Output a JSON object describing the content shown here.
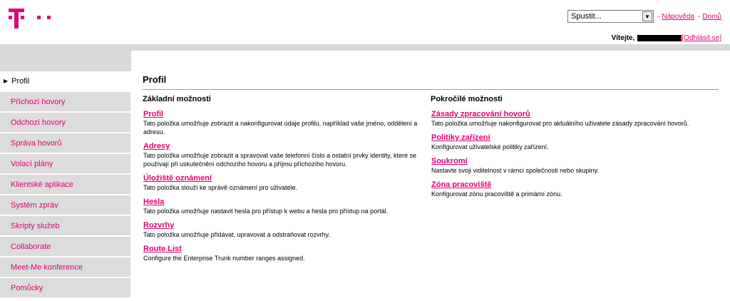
{
  "header": {
    "run_select_value": "Spustit...",
    "help_label": "Nápověda",
    "home_label": "Domů",
    "welcome_label": "Vítejte,",
    "logout_label": "[Odhlásit se]",
    "separator": "-"
  },
  "sidebar": {
    "items": [
      {
        "label": "Profil",
        "active": true
      },
      {
        "label": "Příchozí hovory"
      },
      {
        "label": "Odchozí hovory"
      },
      {
        "label": "Správa hovorů"
      },
      {
        "label": "Volací plány"
      },
      {
        "label": "Klientské aplikace"
      },
      {
        "label": "Systém zpráv"
      },
      {
        "label": "Skripty služeb"
      },
      {
        "label": "Collaborate"
      },
      {
        "label": "Meet-Me konference"
      },
      {
        "label": "Pomůcky"
      }
    ]
  },
  "main": {
    "title": "Profil",
    "basic": {
      "heading": "Základní možnosti",
      "items": [
        {
          "name": "Profil",
          "desc": "Tato položka umožňuje zobrazit a nakonfigurovat údaje profilu, například vaše jméno, oddělení a adresu."
        },
        {
          "name": "Adresy",
          "desc": "Tato položka umožňuje zobrazit a spravovat vaše telefonní číslo a ostatní prvky identity, které se používají při uskutečnění odchozího hovoru a příjmu příchozího hovoru."
        },
        {
          "name": "Úložiště oznámení",
          "desc": "Tato položka slouží ke správě oznámení pro uživatele."
        },
        {
          "name": "Hesla",
          "desc": "Tato položka umožňuje nastavit hesla pro přístup k webu a hesla pro přístup na portál."
        },
        {
          "name": "Rozvrhy",
          "desc": "Tato položka umožňuje přidávat, upravovat a odstraňovat rozvrhy."
        },
        {
          "name": "Route List",
          "desc": "Configure the Enterprise Trunk number ranges assigned."
        }
      ]
    },
    "advanced": {
      "heading": "Pokročilé možnosti",
      "items": [
        {
          "name": "Zásady zpracování hovorů",
          "desc": "Tato položka umožňuje nakonfigurovat pro aktuálního uživatele zásady zpracování hovorů."
        },
        {
          "name": "Politiky zařízení",
          "desc": "Konfigurovat uživatelské politiky zařízení."
        },
        {
          "name": "Soukromí",
          "desc": "Nastavte svoji viditelnost v rámci společnosti nebo skupiny."
        },
        {
          "name": "Zóna pracoviště",
          "desc": "Konfigurovat zónu pracoviště a primární zónu."
        }
      ]
    }
  },
  "colors": {
    "brand": "#e20074",
    "sidebar_bg": "#dcdcdc"
  },
  "icons": {
    "logo": "telekom-t-logo",
    "dropdown": "chevron-down-icon",
    "active_caret": "caret-right-icon"
  }
}
